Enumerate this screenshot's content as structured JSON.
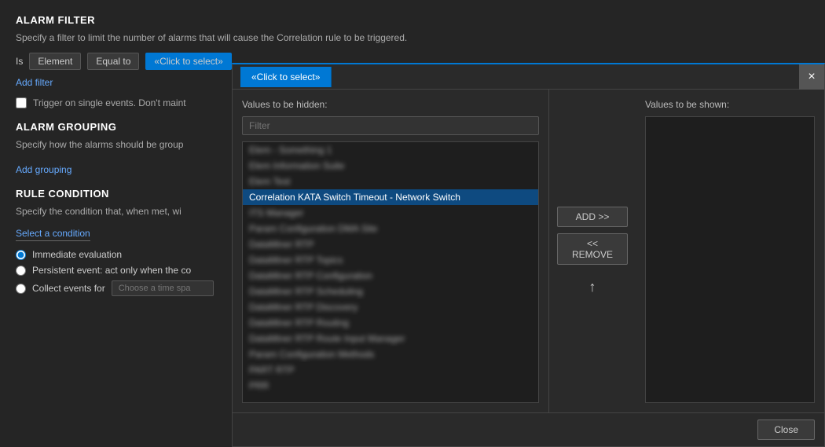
{
  "background": {
    "alarm_filter_title": "ALARM FILTER",
    "alarm_filter_desc": "Specify a filter to limit the number of alarms that will cause the Correlation rule to be triggered.",
    "filter_row": {
      "is_label": "Is",
      "element_label": "Element",
      "equal_to_label": "Equal to",
      "click_to_select": "«Click to select»"
    },
    "add_filter_link": "Add filter",
    "trigger_checkbox_label": "Trigger on single events. Don't maint",
    "alarm_grouping_title": "ALARM GROUPING",
    "alarm_grouping_desc": "Specify how the alarms should be group",
    "add_grouping_link": "Add grouping",
    "rule_condition_title": "RULE CONDITION",
    "rule_condition_desc": "Specify the condition that, when met, wi",
    "select_condition_link": "Select a condition",
    "immediate_eval_label": "Immediate evaluation",
    "persistent_event_label": "Persistent event: act only when the co",
    "collect_events_label": "Collect events for",
    "collect_events_placeholder": "Choose a time spa"
  },
  "modal": {
    "tab_label": "«Click to select»",
    "close_label": "×",
    "values_hidden_label": "Values to be hidden:",
    "values_shown_label": "Values to be shown:",
    "filter_placeholder": "Filter",
    "add_button_label": "ADD >>",
    "remove_button_label": "<< REMOVE",
    "close_button_label": "Close",
    "list_items": [
      {
        "id": 1,
        "text": "Elem - Something 1",
        "blurred": true,
        "selected": false
      },
      {
        "id": 2,
        "text": "Elem Information Suite",
        "blurred": true,
        "selected": false
      },
      {
        "id": 3,
        "text": "Elem Test",
        "blurred": true,
        "selected": false
      },
      {
        "id": 4,
        "text": "Correlation KATA Switch Timeout - Network Switch",
        "blurred": false,
        "selected": true
      },
      {
        "id": 5,
        "text": "ITS Manager",
        "blurred": true,
        "selected": false
      },
      {
        "id": 6,
        "text": "Param Configuration DMA Site",
        "blurred": true,
        "selected": false
      },
      {
        "id": 7,
        "text": "DataMiner RTP",
        "blurred": true,
        "selected": false
      },
      {
        "id": 8,
        "text": "DataMiner RTP Topics",
        "blurred": true,
        "selected": false
      },
      {
        "id": 9,
        "text": "DataMiner RTP Configuration",
        "blurred": true,
        "selected": false
      },
      {
        "id": 10,
        "text": "DataMiner RTP Scheduling",
        "blurred": true,
        "selected": false
      },
      {
        "id": 11,
        "text": "DataMiner RTP Discovery",
        "blurred": true,
        "selected": false
      },
      {
        "id": 12,
        "text": "DataMiner RTP Routing",
        "blurred": true,
        "selected": false
      },
      {
        "id": 13,
        "text": "DataMiner RTP Route Input Manager",
        "blurred": true,
        "selected": false
      },
      {
        "id": 14,
        "text": "Param Configuration Methods",
        "blurred": true,
        "selected": false
      },
      {
        "id": 15,
        "text": "PART RTP",
        "blurred": true,
        "selected": false
      },
      {
        "id": 16,
        "text": "PRR",
        "blurred": true,
        "selected": false
      }
    ]
  }
}
